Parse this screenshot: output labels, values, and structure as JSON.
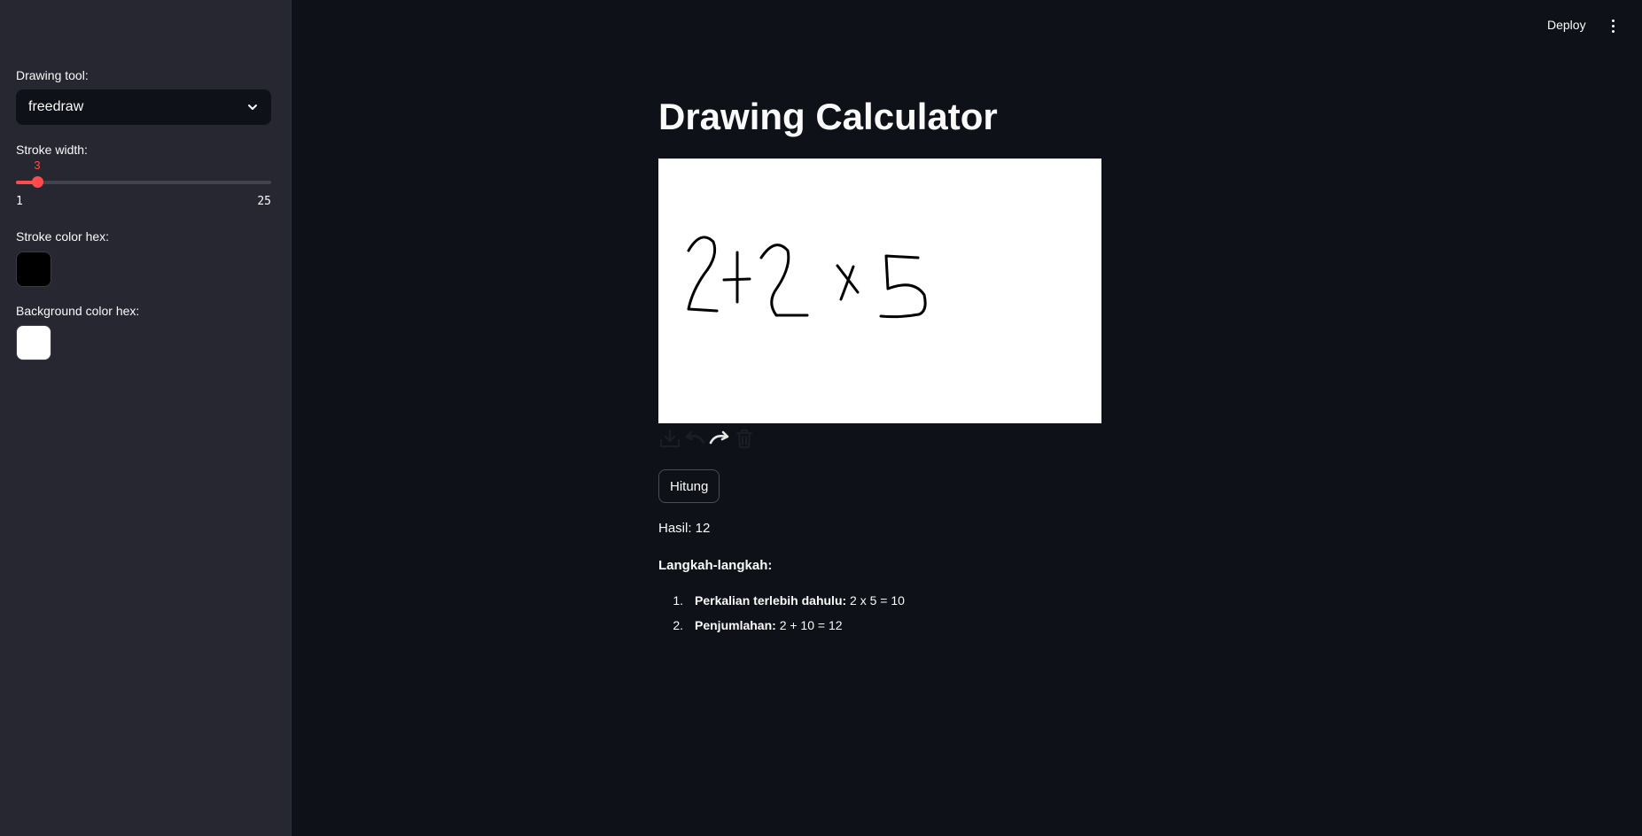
{
  "sidebar": {
    "drawing_tool_label": "Drawing tool:",
    "drawing_tool_value": "freedraw",
    "stroke_width_label": "Stroke width:",
    "stroke_width_value": "3",
    "stroke_width_min": "1",
    "stroke_width_max": "25",
    "stroke_width_fraction": 0.0833,
    "stroke_color_label": "Stroke color hex:",
    "stroke_color": "#000000",
    "background_color_label": "Background color hex:",
    "background_color": "#ffffff"
  },
  "header": {
    "deploy_label": "Deploy"
  },
  "main": {
    "title": "Drawing Calculator",
    "drawn_expression": "2+2 x 5",
    "hitung_label": "Hitung",
    "result_label": "Hasil: 12",
    "steps_heading": "Langkah-langkah:",
    "steps": [
      {
        "num": "1.",
        "bold": "Perkalian terlebih dahulu:",
        "text": "2 x 5 = 10"
      },
      {
        "num": "2.",
        "bold": "Penjumlahan:",
        "text": "2 + 10 = 12"
      }
    ]
  },
  "colors": {
    "accent": "#ff4b4b",
    "background": "#0e1117",
    "sidebar": "#262730"
  }
}
